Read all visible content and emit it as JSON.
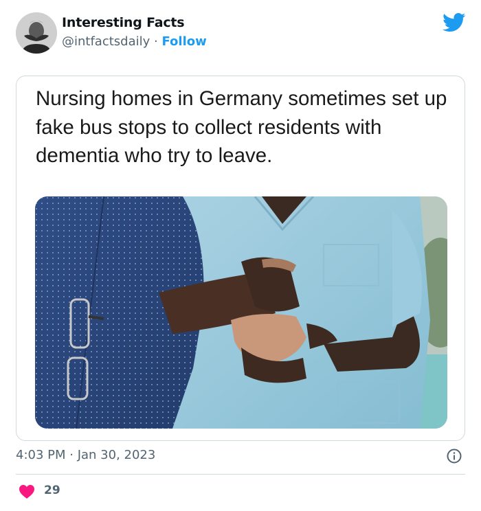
{
  "author": {
    "name": "Interesting Facts",
    "handle": "@intfactsdaily",
    "separator": "·",
    "follow_label": "Follow"
  },
  "card": {
    "headline": "Nursing homes in Germany sometimes set up fake bus stops to collect residents with dementia who try to leave."
  },
  "tweet_meta": {
    "timestamp": "4:03 PM · Jan 30, 2023"
  },
  "engagement": {
    "likes": "29"
  },
  "icons": {
    "brand": "twitter-bird-icon",
    "info": "info-icon",
    "like": "heart-icon"
  },
  "colors": {
    "accent": "#1d9bf0",
    "like": "#f91880",
    "muted_text": "#536471",
    "border": "#cfd9de"
  }
}
